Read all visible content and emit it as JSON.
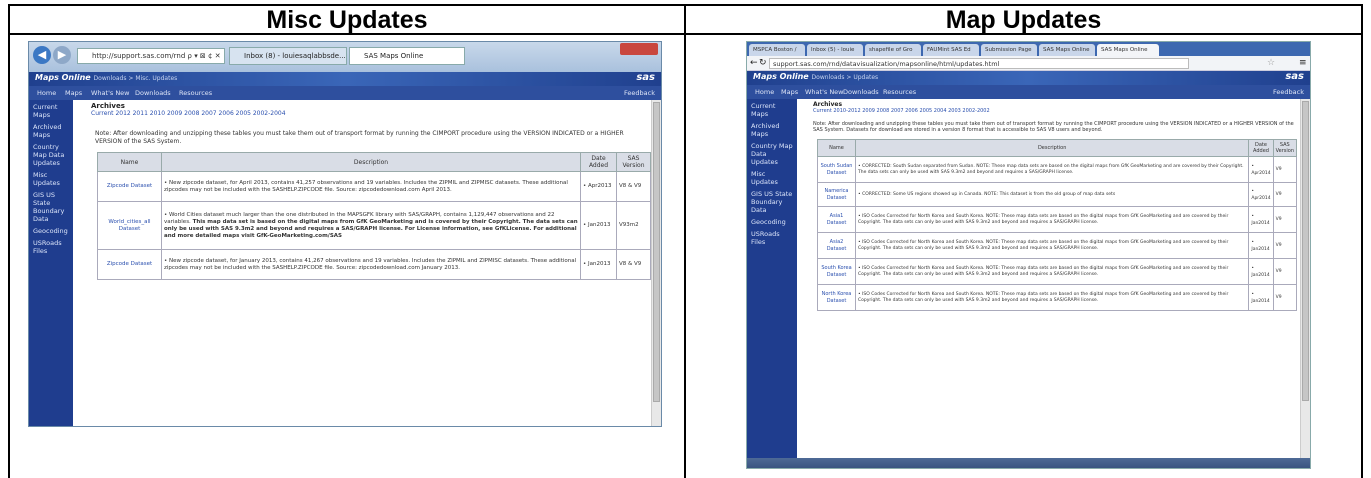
{
  "columns": {
    "left_title": "Misc Updates",
    "right_title": "Map Updates"
  },
  "left": {
    "browser": {
      "address": "http://support.sas.com/rnd ⍴ ▾ ⊠ ¢ ✕",
      "tabs": [
        "Inbox (8) - louiesaqlabbsde...",
        "SAS Maps Online"
      ]
    },
    "site": {
      "title": "Maps Online",
      "breadcrumb": "Downloads > Misc. Updates",
      "logo": "sas",
      "nav": [
        "Home",
        "Maps",
        "What's New",
        "Downloads",
        "Resources"
      ],
      "feedback": "Feedback"
    },
    "sidebar": [
      "Current Maps",
      "Archived Maps",
      "Country Map Data Updates",
      "Misc Updates",
      "GIS US State Boundary Data",
      "Geocoding",
      "USRoads Files"
    ],
    "content": {
      "heading": "Archives",
      "archives": "Current 2012 2011 2010 2009 2008 2007 2006 2005 2002-2004",
      "note": "Note: After downloading and unzipping these tables you must take them out of transport format by running the CIMPORT procedure using the VERSION INDICATED or a HIGHER VERSION of the SAS System.",
      "headers": [
        "Name",
        "Description",
        "Date Added",
        "SAS Version"
      ],
      "rows": [
        {
          "name": "Zipcode Dataset",
          "desc": "• New zipcode dataset, for April 2013, contains 41,257 observations and 19 variables. Includes the ZIPMIL and ZIPMISC datasets. These additional zipcodes may not be included with the SASHELP.ZIPCODE file. Source: zipcodedownload.com April 2013.",
          "bold": "",
          "date": "• Apr2013",
          "ver": "V8 & V9"
        },
        {
          "name": "World_cities_all Dataset",
          "desc": "• World Cities dataset much larger than the one distributed in the MAPSGFK library with SAS/GRAPH, contains 1,129,447 observations and 22 variables.",
          "bold": "This map data set is based on the digital maps from GfK GeoMarketing and is covered by their Copyright. The data sets can only be used with SAS 9.3m2 and beyond and requires a SAS/GRAPH license. For License information, see GfKLicense. For additional and more detailed maps visit GfK-GeoMarketing.com/SAS",
          "date": "• Jan2013",
          "ver": "V93m2"
        },
        {
          "name": "Zipcode Dataset",
          "desc": "• New zipcode dataset, for January 2013, contains 41,267 observations and 19 variables. Includes the ZIPMIL and ZIPMISC datasets. These additional zipcodes may not be included with the SASHELP.ZIPCODE file. Source: zipcodedownload.com January 2013.",
          "bold": "",
          "date": "• Jan2013",
          "ver": "V8 & V9"
        }
      ]
    }
  },
  "right": {
    "browser": {
      "tabs": [
        "MSPCA Boston /",
        "Inbox (5) - louie",
        "shapefile of Gro",
        "FAUMint SAS Ed",
        "Submission Page",
        "SAS Maps Online",
        "SAS Maps Online"
      ],
      "url": "support.sas.com/rnd/datavisualization/mapsonline/html/updates.html"
    },
    "site": {
      "title": "Maps Online",
      "breadcrumb": "Downloads > Updates",
      "logo": "sas",
      "nav": [
        "Home",
        "Maps",
        "What's New",
        "Downloads",
        "Resources"
      ],
      "feedback": "Feedback"
    },
    "sidebar": [
      "Current Maps",
      "Archived Maps",
      "Country Map Data Updates",
      "Misc Updates",
      "GIS US State Boundary Data",
      "Geocoding",
      "USRoads Files"
    ],
    "content": {
      "heading": "Archives",
      "archives": "Current 2010-2012 2009 2008 2007 2006 2005 2004 2003 2002-2002",
      "note": "Note: After downloading and unzipping these tables you must take them out of transport format by running the CIMPORT procedure using the VERSION INDICATED or a HIGHER VERSION of the SAS System. Datasets for download are stored in a version 8 format that is accessible to SAS V8 users and beyond.",
      "headers": [
        "Name",
        "Description",
        "Date Added",
        "SAS Version"
      ],
      "rows": [
        {
          "name": "South Sudan Dataset",
          "desc": "• CORRECTED: South Sudan separated from Sudan. NOTE: These map data sets are based on the digital maps from GfK GeoMarketing and are covered by their Copyright. The data sets can only be used with SAS 9.3m2 and beyond and requires a SAS/GRAPH license.",
          "date": "• Apr2014",
          "ver": "V9"
        },
        {
          "name": "Namerica Dataset",
          "desc": "• CORRECTED: Some US regions showed up in Canada. NOTE: This dataset is from the old group of map data sets",
          "date": "• Apr2014",
          "ver": "V9"
        },
        {
          "name": "Asia1 Dataset",
          "desc": "• ISO Codes Corrected for North Korea and South Korea. NOTE: These map data sets are based on the digital maps from GfK GeoMarketing and are covered by their Copyright. The data sets can only be used with SAS 9.3m2 and beyond and requires a SAS/GRAPH license.",
          "date": "• Jan2014",
          "ver": "V9"
        },
        {
          "name": "Asia2 Dataset",
          "desc": "• ISO Codes Corrected for North Korea and South Korea. NOTE: These map data sets are based on the digital maps from GfK GeoMarketing and are covered by their Copyright. The data sets can only be used with SAS 9.3m2 and beyond and requires a SAS/GRAPH license.",
          "date": "• Jan2014",
          "ver": "V9"
        },
        {
          "name": "South Korea Dataset",
          "desc": "• ISO Codes Corrected for North Korea and South Korea. NOTE: These map data sets are based on the digital maps from GfK GeoMarketing and are covered by their Copyright. The data sets can only be used with SAS 9.3m2 and beyond and requires a SAS/GRAPH license.",
          "date": "• Jan2014",
          "ver": "V9"
        },
        {
          "name": "North Korea Dataset",
          "desc": "• ISO Codes Corrected for North Korea and South Korea. NOTE: These map data sets are based on the digital maps from GfK GeoMarketing and are covered by their Copyright. The data sets can only be used with SAS 9.3m2 and beyond and requires a SAS/GRAPH license.",
          "date": "• Jan2014",
          "ver": "V9"
        }
      ]
    }
  }
}
